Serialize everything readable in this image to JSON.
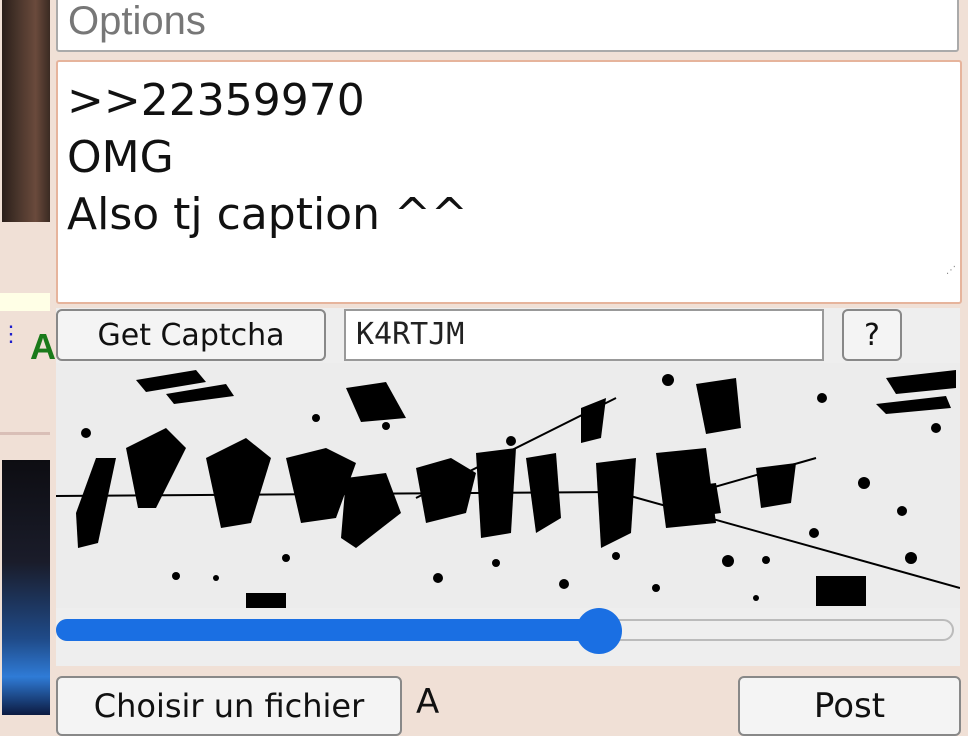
{
  "form": {
    "options_placeholder": "Options",
    "comment_lines": [
      ">>22359970",
      "OMG",
      "Also tj caption ^^"
    ],
    "get_captcha_label": "Get Captcha",
    "captcha_value": "K4RTJM",
    "help_label": "?",
    "slider_fraction": 0.61,
    "file_button_label": "Choisir un fichier",
    "file_name": "A",
    "post_label": "Post"
  },
  "colors": {
    "accent": "#1a6fe3",
    "background": "#f0e0d6",
    "comment_border": "#e6b49c"
  },
  "sidebar": {
    "post_letter": "A"
  }
}
